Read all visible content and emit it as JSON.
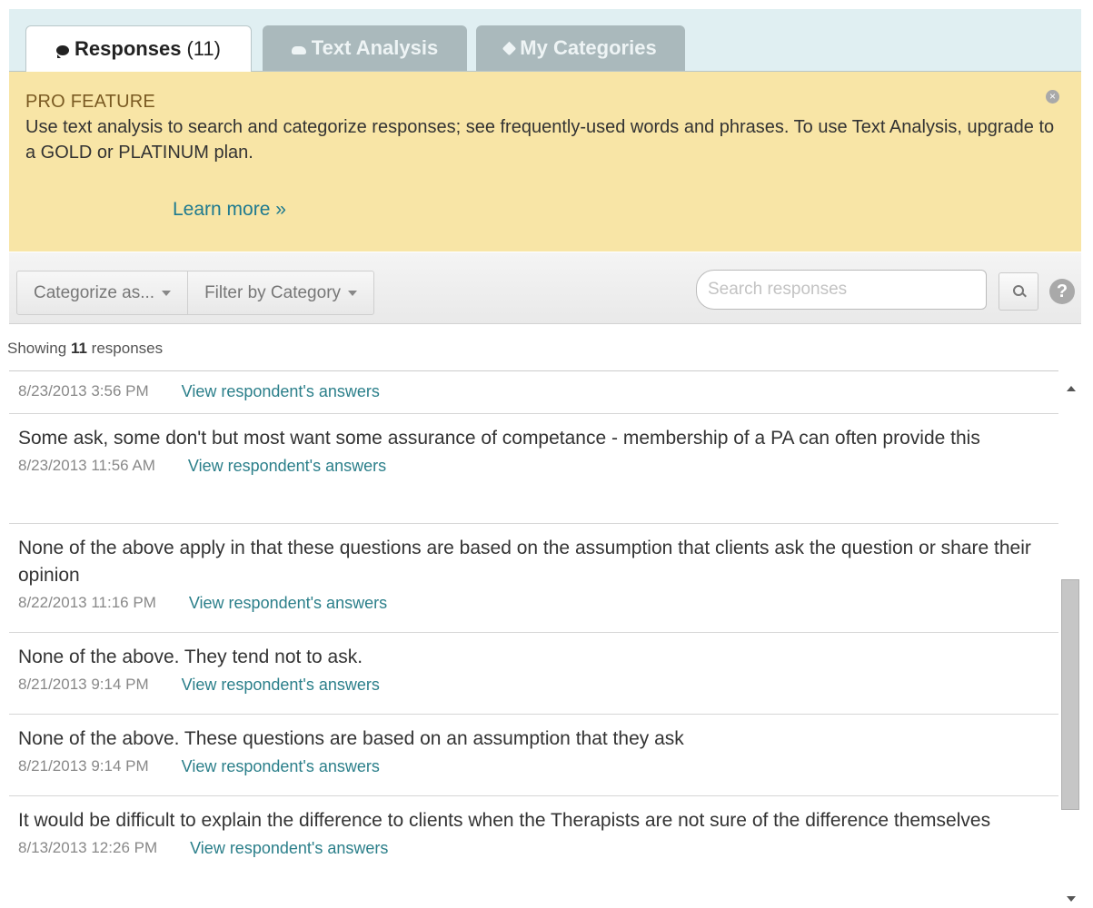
{
  "tabs": [
    {
      "label": "Responses",
      "count": "(11)",
      "icon": "speech-bubble-icon",
      "active": true
    },
    {
      "label": "Text Analysis",
      "icon": "cloud-icon",
      "active": false
    },
    {
      "label": "My Categories",
      "icon": "tag-icon",
      "active": false
    }
  ],
  "banner": {
    "title": "PRO FEATURE",
    "body": "Use text analysis to search and categorize responses; see frequently-used words and phrases. To use Text Analysis, upgrade to a GOLD or PLATINUM plan.",
    "learn_more": "Learn more »",
    "close_icon": "close-icon"
  },
  "toolbar": {
    "categorize": "Categorize as...",
    "filter": "Filter by Category",
    "search_placeholder": "Search responses",
    "help": "?"
  },
  "summary": {
    "prefix": "Showing",
    "count": "11",
    "suffix": "responses"
  },
  "responses": [
    {
      "text": "",
      "date": "8/23/2013 3:56 PM",
      "link": "View respondent's answers"
    },
    {
      "text": "Some ask, some don't but most want some assurance of competance - membership of a PA can often provide this",
      "date": "8/23/2013 11:56 AM",
      "link": "View respondent's answers"
    },
    {
      "text": "None of the above apply in that these questions are based on the assumption that clients ask the question or share their opinion",
      "date": "8/22/2013 11:16 PM",
      "link": "View respondent's answers"
    },
    {
      "text": "None of the above. They tend not to ask.",
      "date": "8/21/2013 9:14 PM",
      "link": "View respondent's answers"
    },
    {
      "text": "None of the above. These questions are based on an assumption that they ask",
      "date": "8/21/2013 9:14 PM",
      "link": "View respondent's answers"
    },
    {
      "text": "It would be difficult to explain the difference to clients when the Therapists are not sure of the difference themselves",
      "date": "8/13/2013 12:26 PM",
      "link": "View respondent's answers"
    }
  ]
}
